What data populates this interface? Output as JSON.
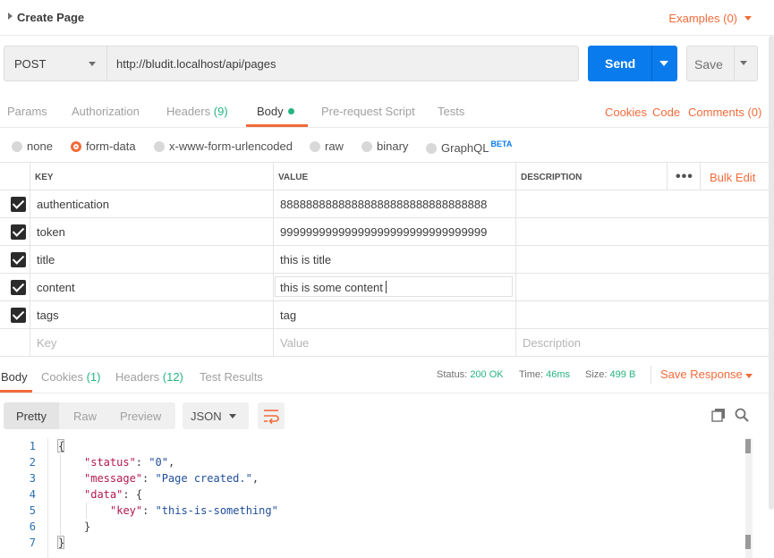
{
  "header": {
    "title": "Create Page",
    "examples_label": "Examples (0)"
  },
  "request": {
    "method": "POST",
    "url": "http://bludit.localhost/api/pages",
    "send_label": "Send",
    "save_label": "Save"
  },
  "request_tabs": {
    "params": "Params",
    "authorization": "Authorization",
    "headers": "Headers",
    "headers_count": "(9)",
    "body": "Body",
    "prerequest": "Pre-request Script",
    "tests": "Tests",
    "cookies": "Cookies",
    "code": "Code",
    "comments": "Comments (0)"
  },
  "body_types": {
    "none": "none",
    "form_data": "form-data",
    "urlencoded": "x-www-form-urlencoded",
    "raw": "raw",
    "binary": "binary",
    "graphql": "GraphQL",
    "beta": "BETA",
    "selected": "form-data"
  },
  "params_table": {
    "headers": {
      "key": "KEY",
      "value": "VALUE",
      "description": "DESCRIPTION",
      "bulk_edit": "Bulk Edit",
      "more": "•••"
    },
    "rows": [
      {
        "key": "authentication",
        "value": "88888888888888888888888888888888",
        "checked": true
      },
      {
        "key": "token",
        "value": "99999999999999999999999999999999",
        "checked": true
      },
      {
        "key": "title",
        "value": "this is title",
        "checked": true
      },
      {
        "key": "content",
        "value": "this is some content",
        "checked": true
      },
      {
        "key": "tags",
        "value": "tag",
        "checked": true
      }
    ],
    "placeholders": {
      "key": "Key",
      "value": "Value",
      "description": "Description"
    }
  },
  "response": {
    "tabs": {
      "body": "Body",
      "cookies": "Cookies",
      "cookies_count": "(1)",
      "headers": "Headers",
      "headers_count": "(12)",
      "test_results": "Test Results"
    },
    "status_label": "Status:",
    "status_value": "200 OK",
    "time_label": "Time:",
    "time_value": "46ms",
    "size_label": "Size:",
    "size_value": "499 B",
    "save_response": "Save Response",
    "formats": {
      "pretty": "Pretty",
      "raw": "Raw",
      "preview": "Preview",
      "selected": "Pretty"
    },
    "language": "JSON",
    "line_numbers": [
      "1",
      "2",
      "3",
      "4",
      "5",
      "6",
      "7"
    ],
    "code": {
      "l1": "{",
      "status_key": "\"status\"",
      "status_val": "\"0\"",
      "message_key": "\"message\"",
      "message_val": "\"Page created.\"",
      "data_key": "\"data\"",
      "data_open": "{",
      "key_key": "\"key\"",
      "key_val": "\"this-is-something\"",
      "inner_close": "}",
      "outer_close": "}"
    }
  },
  "colors": {
    "accent": "#f26b3a",
    "send_blue": "#097bed",
    "success_green": "#26b47f"
  }
}
